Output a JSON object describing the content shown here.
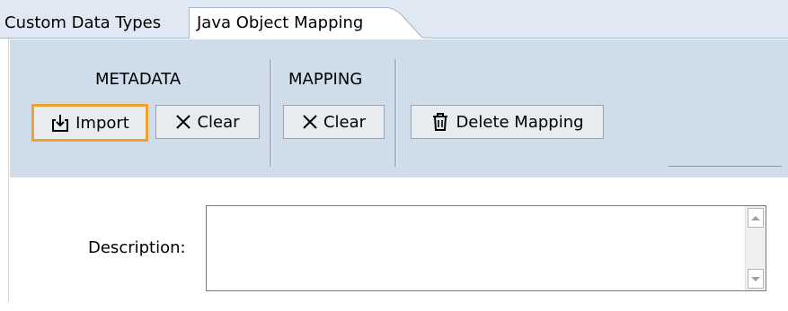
{
  "tabs": [
    {
      "label": "Custom Data Types",
      "active": false
    },
    {
      "label": "Java Object Mapping",
      "active": true
    }
  ],
  "ribbon": {
    "groups": [
      {
        "label": "METADATA",
        "buttons": [
          {
            "label": "Import",
            "icon": "import-icon",
            "focused": true
          },
          {
            "label": "Clear",
            "icon": "clear-x-icon"
          }
        ]
      },
      {
        "label": "MAPPING",
        "buttons": [
          {
            "label": "Clear",
            "icon": "clear-x-icon"
          }
        ]
      },
      {
        "label": "",
        "buttons": [
          {
            "label": "Delete Mapping",
            "icon": "trash-icon"
          }
        ]
      }
    ]
  },
  "form": {
    "description_label": "Description:",
    "description_value": ""
  },
  "colors": {
    "ribbon_bg": "#cfdcea",
    "tabbar_bg": "#dfe8f3",
    "focus_border": "#f0a12e"
  }
}
